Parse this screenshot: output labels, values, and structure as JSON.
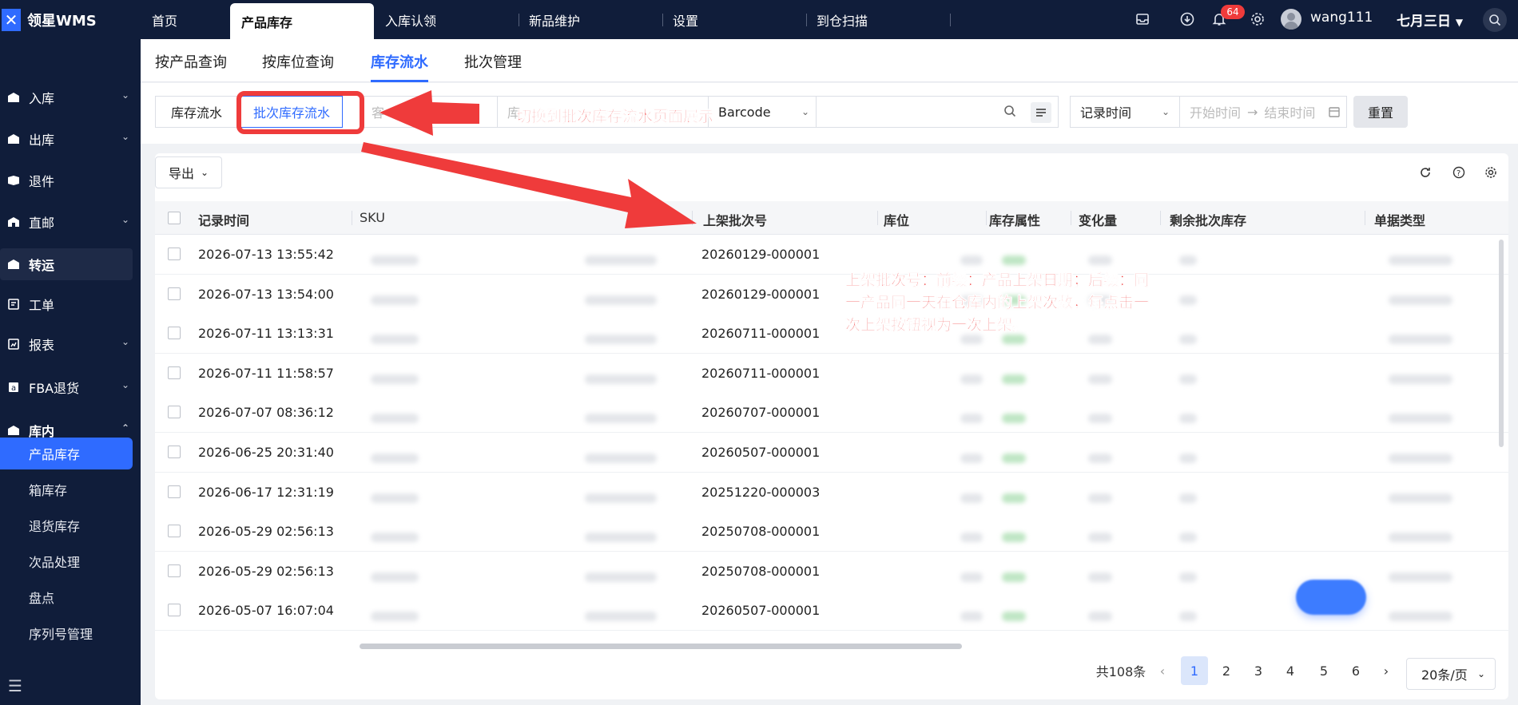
{
  "app": {
    "logo": "领星WMS"
  },
  "top_nav": {
    "tabs": [
      "首页",
      "产品库存",
      "入库认领",
      "新品维护",
      "设置",
      "到仓扫描"
    ],
    "notification_count": "64",
    "username": "wang111",
    "company": "七月三日"
  },
  "sidebar": {
    "items": [
      "入库",
      "出库",
      "退件",
      "直邮",
      "转运",
      "工单",
      "报表",
      "FBA退货",
      "库内"
    ],
    "sub_items": [
      "产品库存",
      "箱库存",
      "退货库存",
      "次品处理",
      "盘点",
      "序列号管理"
    ]
  },
  "sub_tabs": [
    "按产品查询",
    "按库位查询",
    "库存流水",
    "批次管理"
  ],
  "filters": {
    "segment": [
      "库存流水",
      "批次库存流水"
    ],
    "barcode_select": "Barcode",
    "time_select": "记录时间",
    "start_placeholder": "开始时间",
    "end_placeholder": "结束时间",
    "reset": "重置"
  },
  "toolbar": {
    "export": "导出"
  },
  "table": {
    "columns": [
      "记录时间",
      "SKU",
      "上架批次号",
      "库位",
      "库存属性",
      "变化量",
      "剩余批次库存",
      "单据类型"
    ],
    "rows": [
      {
        "time": "2026-07-13 13:55:42",
        "batch": "20260129-000001"
      },
      {
        "time": "2026-07-13 13:54:00",
        "batch": "20260129-000001"
      },
      {
        "time": "2026-07-11 13:13:31",
        "batch": "20260711-000001"
      },
      {
        "time": "2026-07-11 11:58:57",
        "batch": "20260711-000001"
      },
      {
        "time": "2026-07-07 08:36:12",
        "batch": "20260707-000001"
      },
      {
        "time": "2026-06-25 20:31:40",
        "batch": "20260507-000001"
      },
      {
        "time": "2026-06-17 12:31:19",
        "batch": "20251220-000003"
      },
      {
        "time": "2026-05-29 02:56:13",
        "batch": "20250708-000001"
      },
      {
        "time": "2026-05-29 02:56:13",
        "batch": "20250708-000001"
      },
      {
        "time": "2026-05-07 16:07:04",
        "batch": "20260507-000001"
      }
    ]
  },
  "pagination": {
    "total": "共108条",
    "pages": [
      "1",
      "2",
      "3",
      "4",
      "5",
      "6"
    ],
    "current": "1",
    "page_size": "20条/页"
  },
  "annotations": {
    "switch_hint": "切换到批次库存流水页面展示",
    "batch_line1": "上架批次号：前缀：产品上架日期；后缀：同",
    "batch_line2": "一产品同一天在仓库内的上架次数，每点击一",
    "batch_line3": "次上架按钮视为一次上架。"
  },
  "colors": {
    "nav_bg": "#101d3a",
    "accent": "#2f6bff",
    "annotation": "#ef3b3b"
  }
}
